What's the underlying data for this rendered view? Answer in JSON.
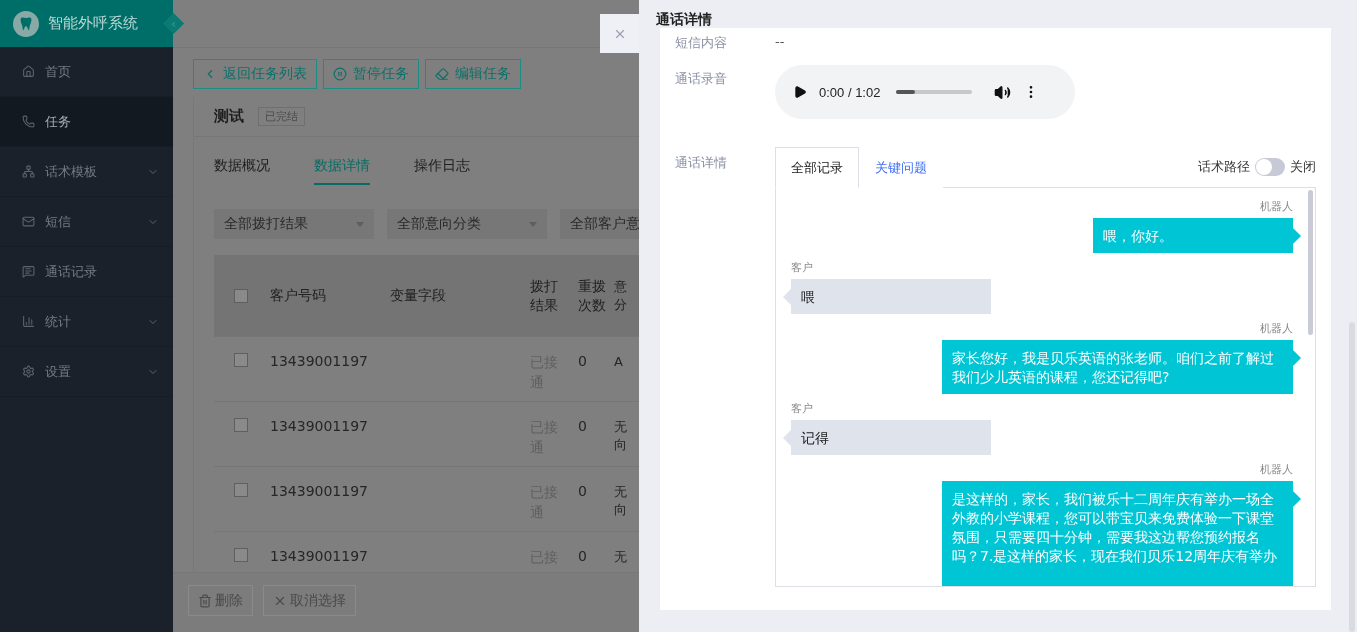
{
  "app": {
    "title": "智能外呼系统"
  },
  "sidebar": {
    "items": [
      {
        "label": "首页",
        "selected": false,
        "submenu": false
      },
      {
        "label": "任务",
        "selected": true,
        "submenu": false
      },
      {
        "label": "话术模板",
        "selected": false,
        "submenu": true
      },
      {
        "label": "短信",
        "selected": false,
        "submenu": true
      },
      {
        "label": "通话记录",
        "selected": false,
        "submenu": false
      },
      {
        "label": "统计",
        "selected": false,
        "submenu": true
      },
      {
        "label": "设置",
        "selected": false,
        "submenu": true
      }
    ]
  },
  "toolbar": {
    "buttons": [
      {
        "label": "返回任务列表"
      },
      {
        "label": "暂停任务"
      },
      {
        "label": "编辑任务"
      }
    ]
  },
  "task": {
    "title": "测试",
    "status": "已完结"
  },
  "tabs": [
    {
      "label": "数据概况",
      "selected": false
    },
    {
      "label": "数据详情",
      "selected": true
    },
    {
      "label": "操作日志",
      "selected": false
    }
  ],
  "filters": [
    "全部拨打结果",
    "全部意向分类",
    "全部客户意"
  ],
  "table": {
    "all_checked": false,
    "columns": [
      "客户号码",
      "变量字段",
      "拨打结果",
      "重拨次数",
      "意分"
    ],
    "rows": [
      {
        "phone": "13439001197",
        "result": "已接通",
        "redials": "0",
        "column_5": "A",
        "checked": false
      },
      {
        "phone": "13439001197",
        "result": "已接通",
        "redials": "0",
        "column_5": "无向",
        "checked": false
      },
      {
        "phone": "13439001197",
        "result": "已接通",
        "redials": "0",
        "column_5": "无向",
        "checked": false
      },
      {
        "phone": "13439001197",
        "result": "已接",
        "redials": "0",
        "column_5": "无",
        "checked": false
      }
    ]
  },
  "footer": {
    "buttons": [
      {
        "label": "删除"
      },
      {
        "label": "取消选择"
      }
    ]
  },
  "drawer": {
    "title": "通话详情",
    "sms": {
      "label": "短信内容",
      "value": "--"
    },
    "recording": {
      "label": "通话录音",
      "time": "0:00 / 1:02",
      "level": 0.25
    },
    "details": {
      "label": "通话详情",
      "tabs": [
        {
          "label": "全部记录",
          "selected": true
        },
        {
          "label": "关键问题",
          "selected": false
        }
      ],
      "path_toggle": {
        "label": "话术路径",
        "on": false,
        "state_text": "关闭"
      },
      "messages": [
        {
          "kind": "robot",
          "speaker": "机器人",
          "text": "喂，你好。"
        },
        {
          "kind": "customer",
          "speaker": "客户",
          "text": "喂"
        },
        {
          "kind": "robot",
          "speaker": "机器人",
          "text": "家长您好，我是贝乐英语的张老师。咱们之前了解过我们少儿英语的课程，您还记得吧?"
        },
        {
          "kind": "customer",
          "speaker": "客户",
          "text": "记得"
        },
        {
          "kind": "robot",
          "speaker": "机器人",
          "text": "是这样的，家长，我们被乐十二周年庆有举办一场全外教的小学课程，您可以带宝贝来免费体验一下课堂氛围，只需要四十分钟，需要我这边帮您预约报名吗？7.是这样的家长，现在我们贝乐12周年庆有举办"
        }
      ]
    }
  }
}
